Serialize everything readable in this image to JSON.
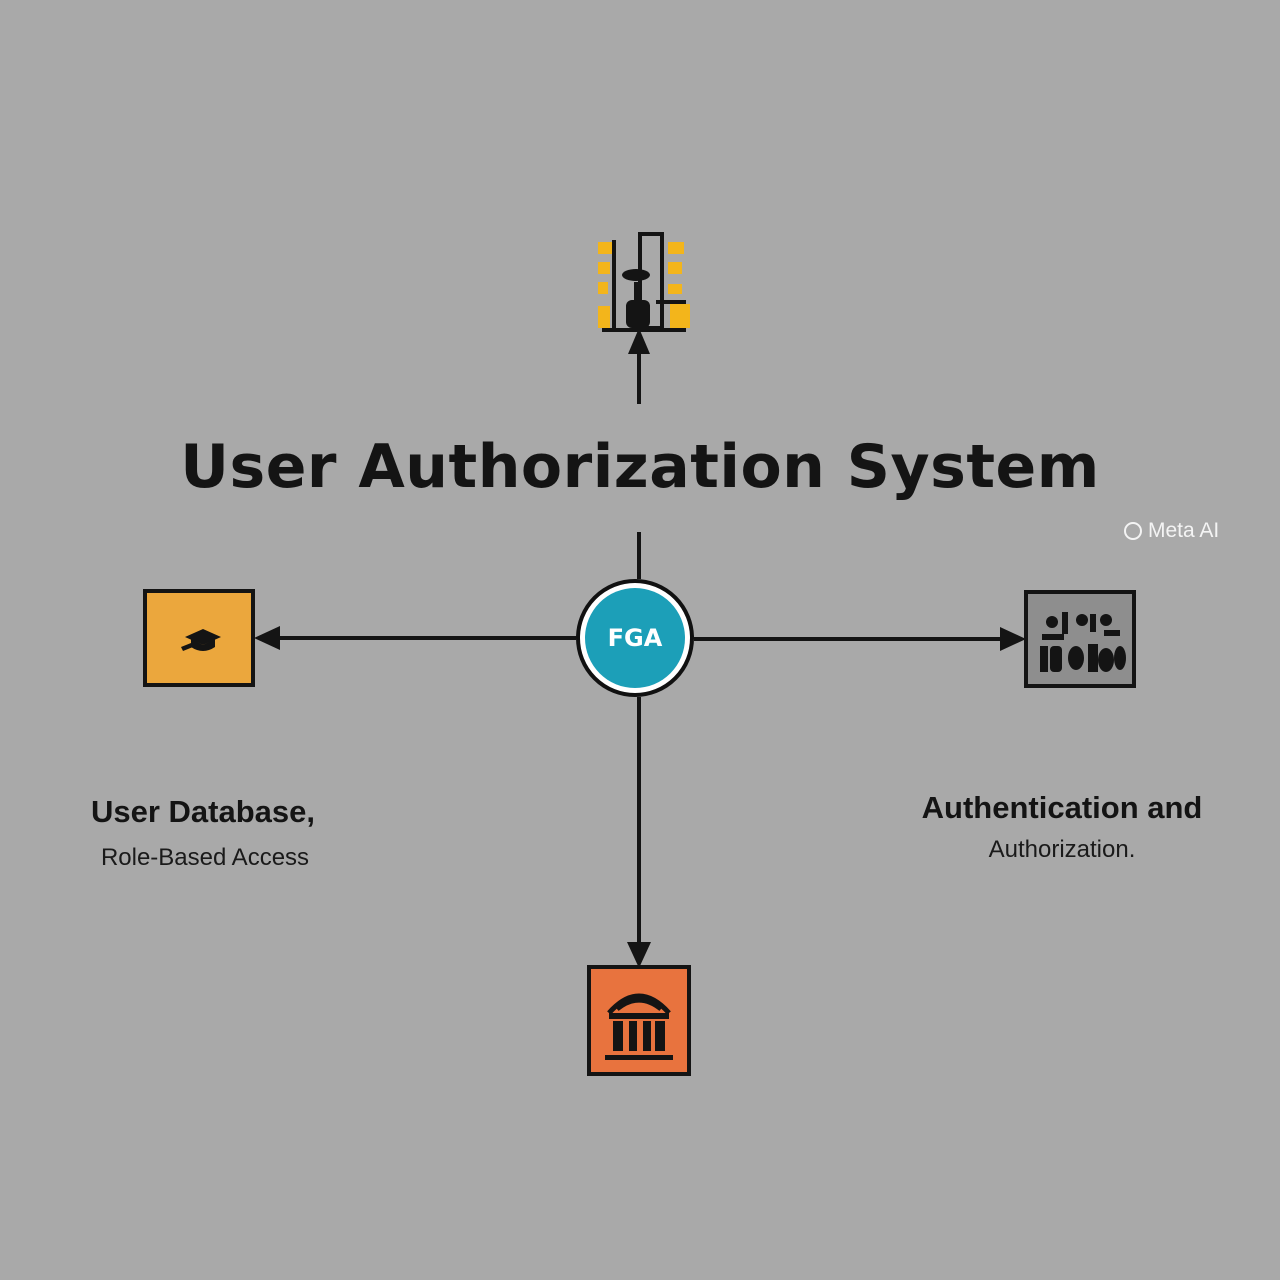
{
  "title": "User Authorization System",
  "center_node": {
    "label": "FGA",
    "fill": "#1c9fb8"
  },
  "nodes": {
    "top": {
      "icon": "server-rack-icon",
      "accent": "#f3b51b"
    },
    "left": {
      "icon": "graduation-cap-icon",
      "fill": "#eba73d"
    },
    "right": {
      "icon": "people-group-icon",
      "fill": "#8e8e8e"
    },
    "bottom": {
      "icon": "building-columns-icon",
      "fill": "#e8733e"
    }
  },
  "labels": {
    "left_line1": "User Database,",
    "left_line2": "Role-Based Access",
    "right_line1": "Authentication and",
    "right_line2": "Authorization."
  },
  "watermark": "Meta AI",
  "colors": {
    "background": "#a9a9a9",
    "line": "#141414"
  }
}
